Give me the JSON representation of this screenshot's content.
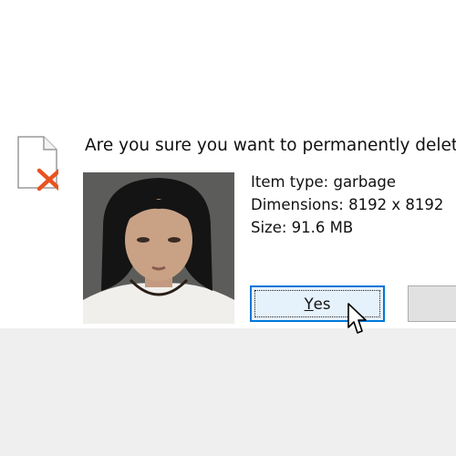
{
  "dialog": {
    "question": "Are you sure you want to permanently delete",
    "details": {
      "item_type": "Item type: garbage",
      "dimensions": "Dimensions: 8192 x 8192",
      "size": "Size: 91.6 MB"
    },
    "yes_prefix": "Y",
    "yes_rest": "es",
    "no_label": ""
  },
  "icons": {
    "file": "blank-file-icon",
    "delete_mark": "red-x-icon",
    "cursor": "mouse-pointer-icon"
  },
  "colors": {
    "accent": "#0078d7",
    "delete_mark": "#e8531f",
    "button_face": "#e5f1fb"
  }
}
